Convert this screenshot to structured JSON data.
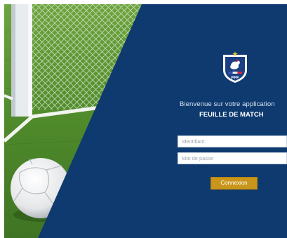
{
  "welcome_text": "Bienvenue sur votre application",
  "app_name": "FEUILLE DE MATCH",
  "login": {
    "username_placeholder": "Identifiant",
    "password_placeholder": "Mot de passe",
    "submit_label": "Connexion"
  },
  "logo": {
    "letters": "FFF"
  },
  "colors": {
    "panel_blue": "#0e3a6f",
    "button_gold": "#c9951a",
    "grass_green": "#4f8a2b"
  }
}
